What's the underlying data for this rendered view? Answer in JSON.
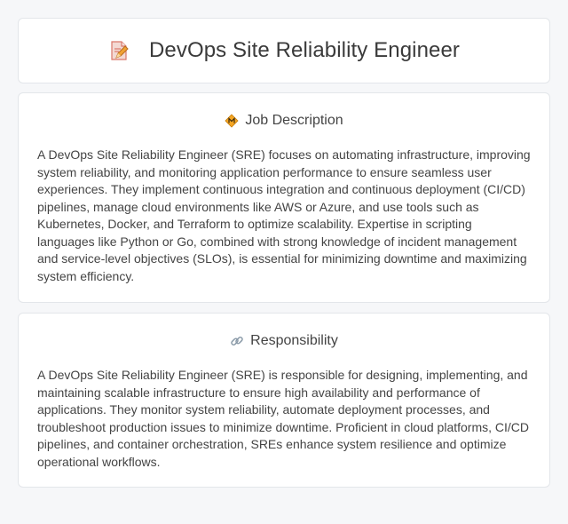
{
  "header": {
    "title": "DevOps Site Reliability Engineer",
    "icon": "document-edit-icon"
  },
  "sections": [
    {
      "heading": "Job Description",
      "icon": "hazard-diamond-icon",
      "body": "A DevOps Site Reliability Engineer (SRE) focuses on automating infrastructure, improving system reliability, and monitoring application performance to ensure seamless user experiences. They implement continuous integration and continuous deployment (CI/CD) pipelines, manage cloud environments like AWS or Azure, and use tools such as Kubernetes, Docker, and Terraform to optimize scalability. Expertise in scripting languages like Python or Go, combined with strong knowledge of incident management and service-level objectives (SLOs), is essential for minimizing downtime and maximizing system efficiency."
    },
    {
      "heading": "Responsibility",
      "icon": "link-icon",
      "body": "A DevOps Site Reliability Engineer (SRE) is responsible for designing, implementing, and maintaining scalable infrastructure to ensure high availability and performance of applications. They monitor system reliability, automate deployment processes, and troubleshoot production issues to minimize downtime. Proficient in cloud platforms, CI/CD pipelines, and container orchestration, SREs enhance system resilience and optimize operational workflows."
    }
  ]
}
